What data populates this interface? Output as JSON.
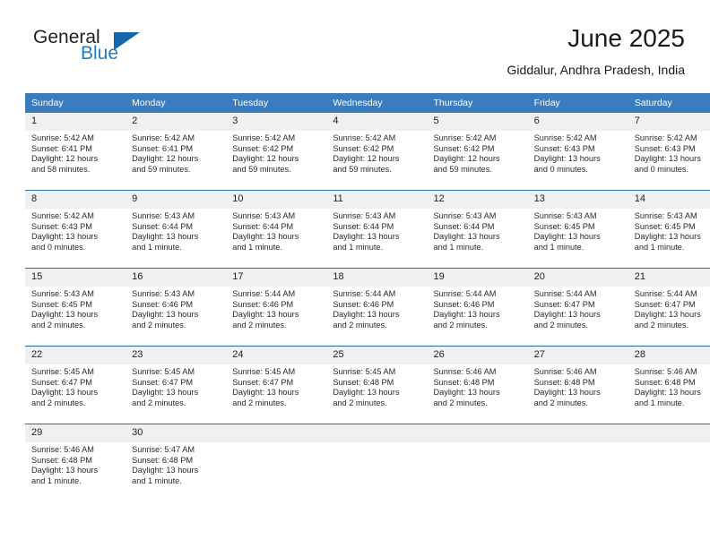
{
  "brand": {
    "name_part1": "General",
    "name_part2": "Blue",
    "logo_icon": "triangle-logo-icon",
    "accent_color": "#1567ad"
  },
  "header": {
    "title": "June 2025",
    "location": "Giddalur, Andhra Pradesh, India"
  },
  "calendar": {
    "header_bg": "#3a7cbe",
    "daynum_bg": "#f0f0f0",
    "separator_color": "#2e6da4",
    "weekday_headers": [
      "Sunday",
      "Monday",
      "Tuesday",
      "Wednesday",
      "Thursday",
      "Friday",
      "Saturday"
    ],
    "weeks": [
      [
        {
          "day": "1",
          "sunrise": "Sunrise: 5:42 AM",
          "sunset": "Sunset: 6:41 PM",
          "daylight_1": "Daylight: 12 hours",
          "daylight_2": "and 58 minutes."
        },
        {
          "day": "2",
          "sunrise": "Sunrise: 5:42 AM",
          "sunset": "Sunset: 6:41 PM",
          "daylight_1": "Daylight: 12 hours",
          "daylight_2": "and 59 minutes."
        },
        {
          "day": "3",
          "sunrise": "Sunrise: 5:42 AM",
          "sunset": "Sunset: 6:42 PM",
          "daylight_1": "Daylight: 12 hours",
          "daylight_2": "and 59 minutes."
        },
        {
          "day": "4",
          "sunrise": "Sunrise: 5:42 AM",
          "sunset": "Sunset: 6:42 PM",
          "daylight_1": "Daylight: 12 hours",
          "daylight_2": "and 59 minutes."
        },
        {
          "day": "5",
          "sunrise": "Sunrise: 5:42 AM",
          "sunset": "Sunset: 6:42 PM",
          "daylight_1": "Daylight: 12 hours",
          "daylight_2": "and 59 minutes."
        },
        {
          "day": "6",
          "sunrise": "Sunrise: 5:42 AM",
          "sunset": "Sunset: 6:43 PM",
          "daylight_1": "Daylight: 13 hours",
          "daylight_2": "and 0 minutes."
        },
        {
          "day": "7",
          "sunrise": "Sunrise: 5:42 AM",
          "sunset": "Sunset: 6:43 PM",
          "daylight_1": "Daylight: 13 hours",
          "daylight_2": "and 0 minutes."
        }
      ],
      [
        {
          "day": "8",
          "sunrise": "Sunrise: 5:42 AM",
          "sunset": "Sunset: 6:43 PM",
          "daylight_1": "Daylight: 13 hours",
          "daylight_2": "and 0 minutes."
        },
        {
          "day": "9",
          "sunrise": "Sunrise: 5:43 AM",
          "sunset": "Sunset: 6:44 PM",
          "daylight_1": "Daylight: 13 hours",
          "daylight_2": "and 1 minute."
        },
        {
          "day": "10",
          "sunrise": "Sunrise: 5:43 AM",
          "sunset": "Sunset: 6:44 PM",
          "daylight_1": "Daylight: 13 hours",
          "daylight_2": "and 1 minute."
        },
        {
          "day": "11",
          "sunrise": "Sunrise: 5:43 AM",
          "sunset": "Sunset: 6:44 PM",
          "daylight_1": "Daylight: 13 hours",
          "daylight_2": "and 1 minute."
        },
        {
          "day": "12",
          "sunrise": "Sunrise: 5:43 AM",
          "sunset": "Sunset: 6:44 PM",
          "daylight_1": "Daylight: 13 hours",
          "daylight_2": "and 1 minute."
        },
        {
          "day": "13",
          "sunrise": "Sunrise: 5:43 AM",
          "sunset": "Sunset: 6:45 PM",
          "daylight_1": "Daylight: 13 hours",
          "daylight_2": "and 1 minute."
        },
        {
          "day": "14",
          "sunrise": "Sunrise: 5:43 AM",
          "sunset": "Sunset: 6:45 PM",
          "daylight_1": "Daylight: 13 hours",
          "daylight_2": "and 1 minute."
        }
      ],
      [
        {
          "day": "15",
          "sunrise": "Sunrise: 5:43 AM",
          "sunset": "Sunset: 6:45 PM",
          "daylight_1": "Daylight: 13 hours",
          "daylight_2": "and 2 minutes."
        },
        {
          "day": "16",
          "sunrise": "Sunrise: 5:43 AM",
          "sunset": "Sunset: 6:46 PM",
          "daylight_1": "Daylight: 13 hours",
          "daylight_2": "and 2 minutes."
        },
        {
          "day": "17",
          "sunrise": "Sunrise: 5:44 AM",
          "sunset": "Sunset: 6:46 PM",
          "daylight_1": "Daylight: 13 hours",
          "daylight_2": "and 2 minutes."
        },
        {
          "day": "18",
          "sunrise": "Sunrise: 5:44 AM",
          "sunset": "Sunset: 6:46 PM",
          "daylight_1": "Daylight: 13 hours",
          "daylight_2": "and 2 minutes."
        },
        {
          "day": "19",
          "sunrise": "Sunrise: 5:44 AM",
          "sunset": "Sunset: 6:46 PM",
          "daylight_1": "Daylight: 13 hours",
          "daylight_2": "and 2 minutes."
        },
        {
          "day": "20",
          "sunrise": "Sunrise: 5:44 AM",
          "sunset": "Sunset: 6:47 PM",
          "daylight_1": "Daylight: 13 hours",
          "daylight_2": "and 2 minutes."
        },
        {
          "day": "21",
          "sunrise": "Sunrise: 5:44 AM",
          "sunset": "Sunset: 6:47 PM",
          "daylight_1": "Daylight: 13 hours",
          "daylight_2": "and 2 minutes."
        }
      ],
      [
        {
          "day": "22",
          "sunrise": "Sunrise: 5:45 AM",
          "sunset": "Sunset: 6:47 PM",
          "daylight_1": "Daylight: 13 hours",
          "daylight_2": "and 2 minutes."
        },
        {
          "day": "23",
          "sunrise": "Sunrise: 5:45 AM",
          "sunset": "Sunset: 6:47 PM",
          "daylight_1": "Daylight: 13 hours",
          "daylight_2": "and 2 minutes."
        },
        {
          "day": "24",
          "sunrise": "Sunrise: 5:45 AM",
          "sunset": "Sunset: 6:47 PM",
          "daylight_1": "Daylight: 13 hours",
          "daylight_2": "and 2 minutes."
        },
        {
          "day": "25",
          "sunrise": "Sunrise: 5:45 AM",
          "sunset": "Sunset: 6:48 PM",
          "daylight_1": "Daylight: 13 hours",
          "daylight_2": "and 2 minutes."
        },
        {
          "day": "26",
          "sunrise": "Sunrise: 5:46 AM",
          "sunset": "Sunset: 6:48 PM",
          "daylight_1": "Daylight: 13 hours",
          "daylight_2": "and 2 minutes."
        },
        {
          "day": "27",
          "sunrise": "Sunrise: 5:46 AM",
          "sunset": "Sunset: 6:48 PM",
          "daylight_1": "Daylight: 13 hours",
          "daylight_2": "and 2 minutes."
        },
        {
          "day": "28",
          "sunrise": "Sunrise: 5:46 AM",
          "sunset": "Sunset: 6:48 PM",
          "daylight_1": "Daylight: 13 hours",
          "daylight_2": "and 1 minute."
        }
      ],
      [
        {
          "day": "29",
          "sunrise": "Sunrise: 5:46 AM",
          "sunset": "Sunset: 6:48 PM",
          "daylight_1": "Daylight: 13 hours",
          "daylight_2": "and 1 minute."
        },
        {
          "day": "30",
          "sunrise": "Sunrise: 5:47 AM",
          "sunset": "Sunset: 6:48 PM",
          "daylight_1": "Daylight: 13 hours",
          "daylight_2": "and 1 minute."
        },
        {
          "day": "",
          "sunrise": "",
          "sunset": "",
          "daylight_1": "",
          "daylight_2": ""
        },
        {
          "day": "",
          "sunrise": "",
          "sunset": "",
          "daylight_1": "",
          "daylight_2": ""
        },
        {
          "day": "",
          "sunrise": "",
          "sunset": "",
          "daylight_1": "",
          "daylight_2": ""
        },
        {
          "day": "",
          "sunrise": "",
          "sunset": "",
          "daylight_1": "",
          "daylight_2": ""
        },
        {
          "day": "",
          "sunrise": "",
          "sunset": "",
          "daylight_1": "",
          "daylight_2": ""
        }
      ]
    ]
  }
}
